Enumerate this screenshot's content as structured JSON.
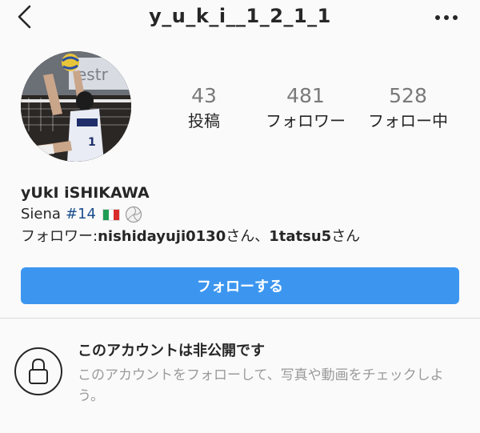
{
  "header": {
    "username": "y_u_k_i__1_2_1_1",
    "back_icon": "chevron-left-icon",
    "more_icon": "more-horizontal-icon"
  },
  "profile": {
    "stats": [
      {
        "value": "43",
        "label": "投稿"
      },
      {
        "value": "481",
        "label": "フォロワー"
      },
      {
        "value": "528",
        "label": "フォロー中"
      }
    ],
    "name": "yUkI iSHIKAWA",
    "bio_line_prefix": "Siena",
    "bio_hashtag": "#14",
    "bio_flag": "italy-flag-icon",
    "bio_emoji": "volleyball-icon",
    "followers_prefix": "フォロワー: ",
    "follower1": "nishidayuji0130",
    "follower1_suffix": "さん、",
    "follower2": "1tatsu5",
    "follower2_suffix": "さん"
  },
  "actions": {
    "follow_label": "フォローする",
    "follow_color": "#3c96ef"
  },
  "private": {
    "title": "このアカウントは非公開です",
    "description": "このアカウントをフォローして、写真や動画をチェックしよう。",
    "lock_icon": "lock-icon"
  }
}
